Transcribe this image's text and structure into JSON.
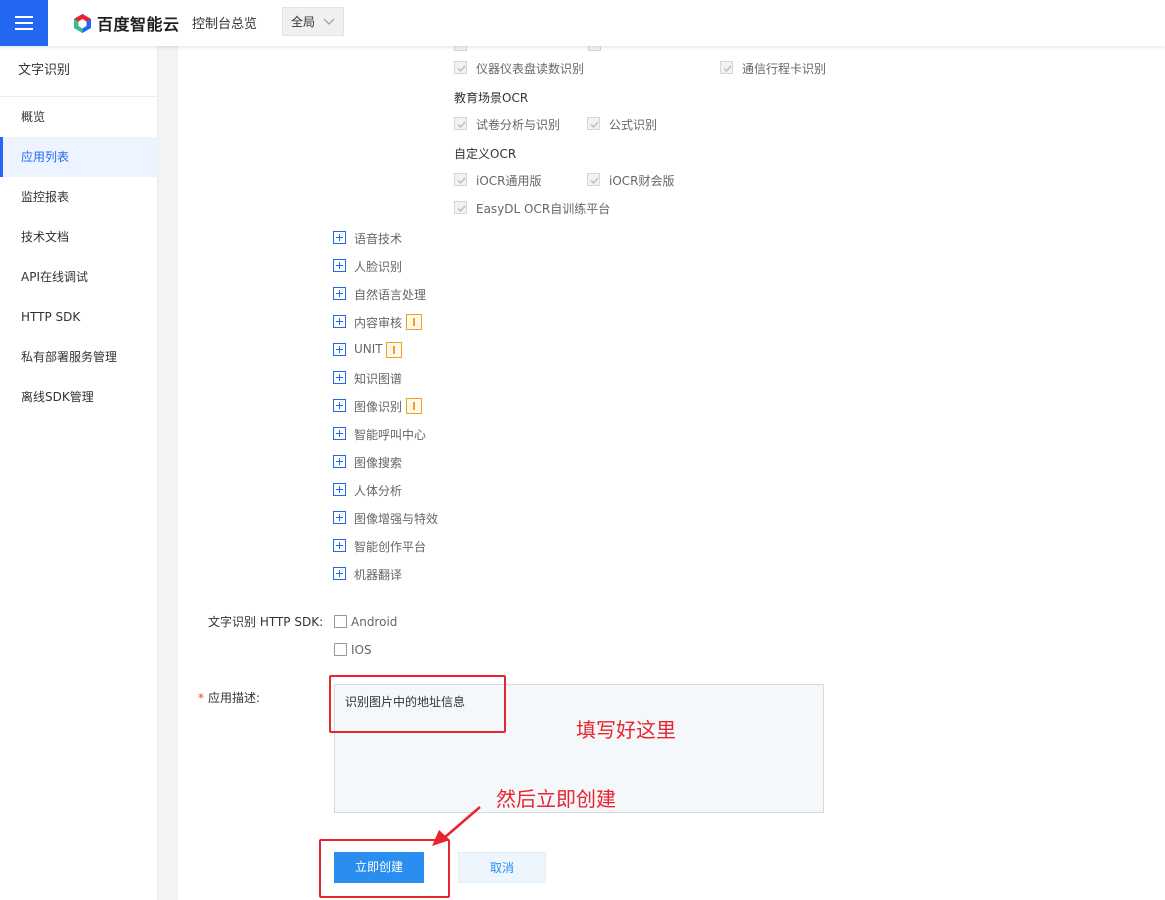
{
  "header": {
    "brand": "百度智能云",
    "console_link": "控制台总览",
    "region": "全局"
  },
  "sidebar": {
    "title": "文字识别",
    "items": [
      {
        "label": "概览"
      },
      {
        "label": "应用列表",
        "active": true
      },
      {
        "label": "监控报表"
      },
      {
        "label": "技术文档"
      },
      {
        "label": "API在线调试"
      },
      {
        "label": "HTTP SDK"
      },
      {
        "label": "私有部署服务管理"
      },
      {
        "label": "离线SDK管理"
      }
    ]
  },
  "ocr_options": {
    "row1": [
      "仪器仪表盘读数识别",
      "通信行程卡识别"
    ],
    "education_title": "教育场景OCR",
    "education": [
      "试卷分析与识别",
      "公式识别"
    ],
    "custom_title": "自定义OCR",
    "custom": [
      "iOCR通用版",
      "iOCR财会版",
      "EasyDL OCR自训练平台"
    ]
  },
  "service_tree": [
    {
      "label": "语音技术",
      "warn": false
    },
    {
      "label": "人脸识别",
      "warn": false
    },
    {
      "label": "自然语言处理",
      "warn": false
    },
    {
      "label": "内容审核",
      "warn": true
    },
    {
      "label": "UNIT",
      "warn": true
    },
    {
      "label": "知识图谱",
      "warn": false
    },
    {
      "label": "图像识别",
      "warn": true
    },
    {
      "label": "智能呼叫中心",
      "warn": false
    },
    {
      "label": "图像搜索",
      "warn": false
    },
    {
      "label": "人体分析",
      "warn": false
    },
    {
      "label": "图像增强与特效",
      "warn": false
    },
    {
      "label": "智能创作平台",
      "warn": false
    },
    {
      "label": "机器翻译",
      "warn": false
    }
  ],
  "sdk": {
    "label": "文字识别 HTTP SDK:",
    "options": [
      "Android",
      "IOS"
    ]
  },
  "description": {
    "required_mark": "*",
    "label": "应用描述:",
    "value": "识别图片中的地址信息"
  },
  "annotations": {
    "fill_here": "填写好这里",
    "then_create": "然后立即创建"
  },
  "buttons": {
    "create": "立即创建",
    "cancel": "取消"
  },
  "colors": {
    "primary": "#2468f2",
    "button": "#2a8ef0",
    "annotation": "#e8242e",
    "warning": "#f0a020"
  }
}
